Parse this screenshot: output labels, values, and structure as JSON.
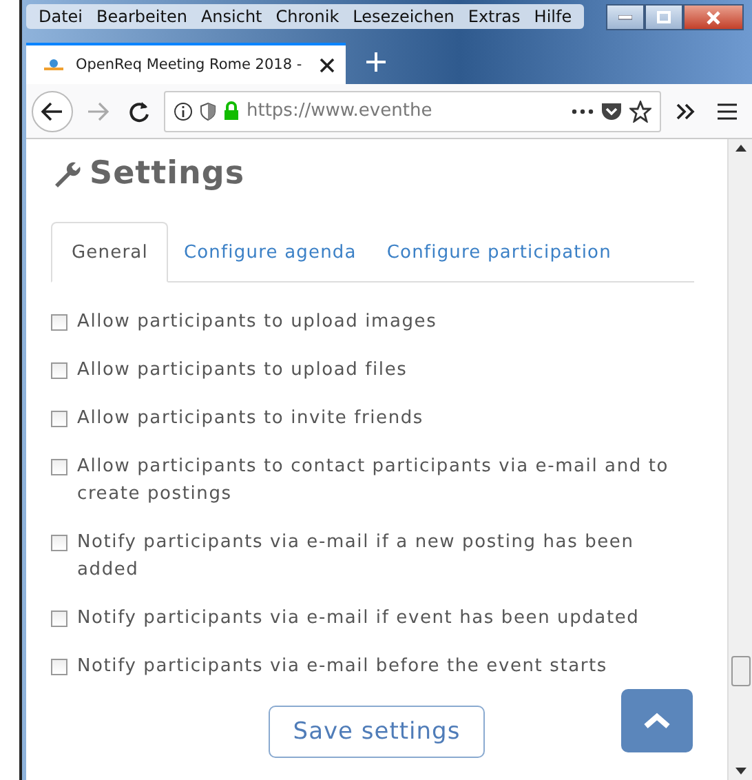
{
  "menu": [
    "Datei",
    "Bearbeiten",
    "Ansicht",
    "Chronik",
    "Lesezeichen",
    "Extras",
    "Hilfe"
  ],
  "browser_tab": {
    "title": "OpenReq Meeting Rome 2018 -"
  },
  "address_bar": {
    "url": "https://www.eventhe"
  },
  "heading": "Settings",
  "tabs": [
    {
      "label": "General",
      "selected": true
    },
    {
      "label": "Configure agenda",
      "selected": false
    },
    {
      "label": "Configure participation",
      "selected": false
    }
  ],
  "options": [
    {
      "label": "Allow participants to upload images",
      "checked": false
    },
    {
      "label": "Allow participants to upload files",
      "checked": false
    },
    {
      "label": "Allow participants to invite friends",
      "checked": false
    },
    {
      "label": "Allow participants to contact participants via e-mail and to create postings",
      "checked": false
    },
    {
      "label": "Notify participants via e-mail if a new posting has been added",
      "checked": false
    },
    {
      "label": "Notify participants via e-mail if event has been updated",
      "checked": false
    },
    {
      "label": "Notify participants via e-mail before the event starts",
      "checked": false
    }
  ],
  "save_button": "Save settings"
}
